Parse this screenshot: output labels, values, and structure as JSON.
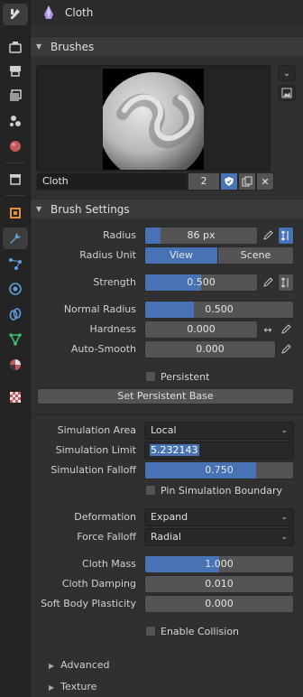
{
  "tabs": [
    {
      "name": "tool-settings-tab",
      "icon": "tool-icon",
      "active": true
    },
    {
      "name": "render-tab",
      "icon": "render-icon"
    },
    {
      "name": "output-tab",
      "icon": "output-icon"
    },
    {
      "name": "view-layer-tab",
      "icon": "view-layer-icon"
    },
    {
      "name": "scene-tab",
      "icon": "scene-icon"
    },
    {
      "name": "world-tab",
      "icon": "world-icon"
    },
    {
      "name": "collection-tab",
      "icon": "collection-icon"
    },
    {
      "name": "object-tab",
      "icon": "object-icon"
    },
    {
      "name": "modifier-tab",
      "icon": "wrench-icon"
    },
    {
      "name": "particles-tab",
      "icon": "particles-icon"
    },
    {
      "name": "physics-tab",
      "icon": "physics-icon"
    },
    {
      "name": "constraints-tab",
      "icon": "constraints-icon"
    },
    {
      "name": "data-tab",
      "icon": "mesh-data-icon"
    },
    {
      "name": "material-tab",
      "icon": "material-icon"
    },
    {
      "name": "texture-tab",
      "icon": "texture-icon"
    }
  ],
  "header": {
    "title": "Cloth"
  },
  "brushes": {
    "panel_label": "Brushes",
    "brush_name": "Cloth",
    "users": "2"
  },
  "brush_settings": {
    "panel_label": "Brush Settings",
    "radius": {
      "label": "Radius",
      "value": "86 px",
      "fill": 0.14
    },
    "radius_unit": {
      "label": "Radius Unit",
      "options": [
        "View",
        "Scene"
      ],
      "selected": "View"
    },
    "strength": {
      "label": "Strength",
      "value": "0.500",
      "fill": 0.5
    },
    "normal_radius": {
      "label": "Normal Radius",
      "value": "0.500",
      "fill": 0.33
    },
    "hardness": {
      "label": "Hardness",
      "value": "0.000"
    },
    "auto_smooth": {
      "label": "Auto-Smooth",
      "value": "0.000"
    },
    "persistent": {
      "label": "Persistent",
      "checked": false
    },
    "set_persistent_base": "Set Persistent Base",
    "simulation_area": {
      "label": "Simulation Area",
      "value": "Local"
    },
    "simulation_limit": {
      "label": "Simulation Limit",
      "value": "5.232143"
    },
    "simulation_falloff": {
      "label": "Simulation Falloff",
      "value": "0.750",
      "fill": 0.75
    },
    "pin_boundary": {
      "label": "Pin Simulation Boundary",
      "checked": false
    },
    "deformation": {
      "label": "Deformation",
      "value": "Expand"
    },
    "force_falloff": {
      "label": "Force Falloff",
      "value": "Radial"
    },
    "cloth_mass": {
      "label": "Cloth Mass",
      "value": "1.000",
      "fill": 0.5
    },
    "cloth_damping": {
      "label": "Cloth Damping",
      "value": "0.010"
    },
    "soft_body_plasticity": {
      "label": "Soft Body Plasticity",
      "value": "0.000"
    },
    "enable_collision": {
      "label": "Enable Collision",
      "checked": false
    }
  },
  "subpanels": [
    "Advanced",
    "Texture"
  ],
  "colors": {
    "accent": "#4772b3",
    "field": "#545454",
    "dark_field": "#282828",
    "bg": "#303030"
  }
}
